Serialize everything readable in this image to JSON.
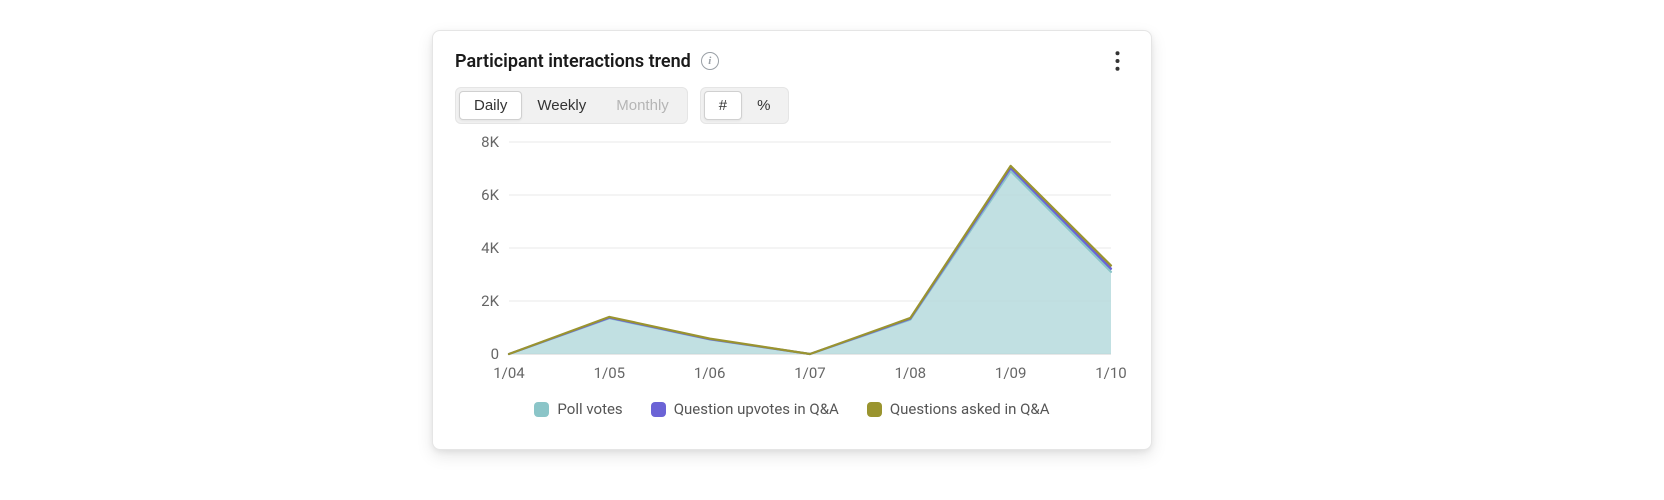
{
  "card": {
    "title": "Participant interactions trend"
  },
  "controls": {
    "granularity": [
      {
        "label": "Daily",
        "state": "selected"
      },
      {
        "label": "Weekly",
        "state": "default"
      },
      {
        "label": "Monthly",
        "state": "disabled"
      }
    ],
    "mode": [
      {
        "label": "#",
        "state": "selected"
      },
      {
        "label": "%",
        "state": "default"
      }
    ]
  },
  "legend": [
    {
      "key": "poll",
      "label": "Poll votes",
      "color": "#8bc5c8"
    },
    {
      "key": "upvotes",
      "label": "Question upvotes in Q&A",
      "color": "#6b63d6"
    },
    {
      "key": "asked",
      "label": "Questions asked in Q&A",
      "color": "#9a942f"
    }
  ],
  "chart_data": {
    "type": "area",
    "title": "Participant interactions trend",
    "xlabel": "",
    "ylabel": "",
    "x": [
      "1/04",
      "1/05",
      "1/06",
      "1/07",
      "1/08",
      "1/09",
      "1/10"
    ],
    "yticks": [
      0,
      2000,
      4000,
      6000,
      8000
    ],
    "ytick_labels": [
      "0",
      "2K",
      "4K",
      "6K",
      "8K"
    ],
    "ylim": [
      0,
      8000
    ],
    "stacked": true,
    "series": [
      {
        "name": "Poll votes",
        "key": "poll",
        "color": "#8bc5c8",
        "fill": "#b6dadd",
        "values": [
          0,
          1350,
          550,
          0,
          1300,
          6900,
          3100
        ]
      },
      {
        "name": "Question upvotes in Q&A",
        "key": "upvotes",
        "color": "#6b63d6",
        "fill": "#6b63d6",
        "values": [
          0,
          20,
          10,
          0,
          30,
          120,
          120
        ]
      },
      {
        "name": "Questions asked in Q&A",
        "key": "asked",
        "color": "#9a942f",
        "fill": "#9a942f",
        "values": [
          0,
          30,
          20,
          0,
          30,
          80,
          120
        ]
      }
    ],
    "legend_position": "bottom",
    "grid": true
  }
}
